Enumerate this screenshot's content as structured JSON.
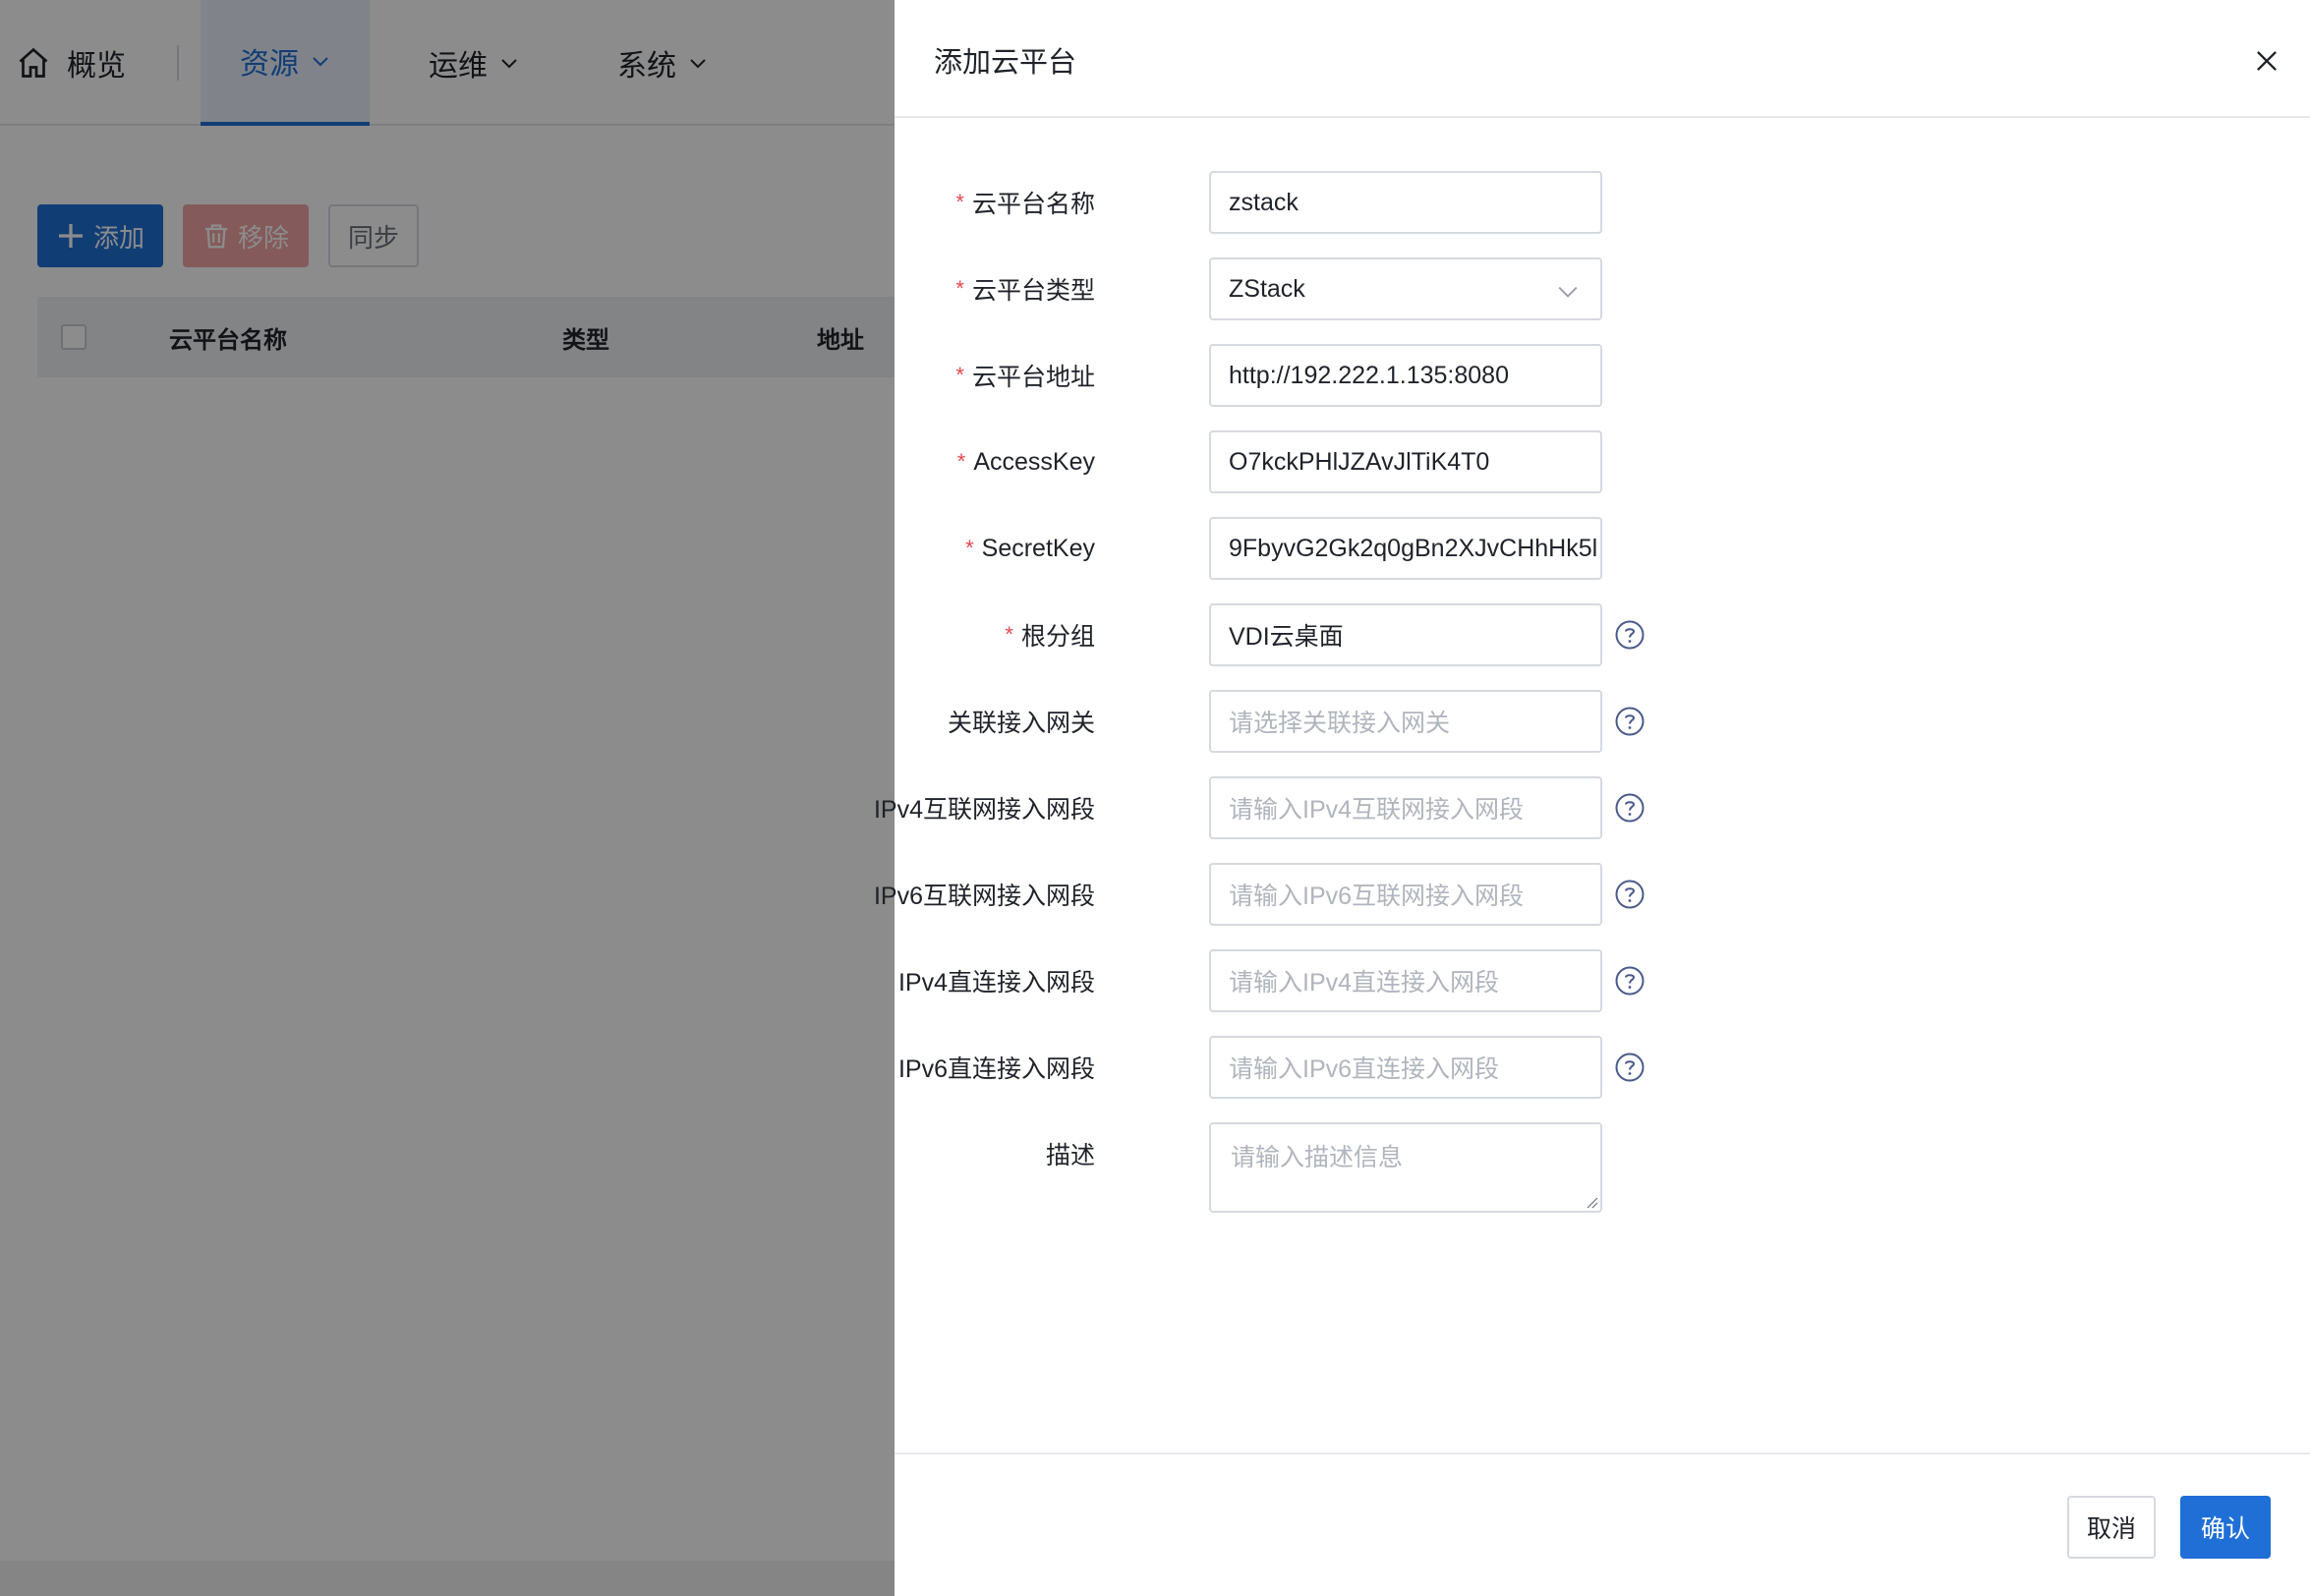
{
  "nav": {
    "overview": "概览",
    "resources": "资源",
    "operations": "运维",
    "system": "系统"
  },
  "toolbar": {
    "add_label": "添加",
    "remove_label": "移除",
    "sync_label": "同步"
  },
  "table": {
    "columns": [
      "云平台名称",
      "类型",
      "地址"
    ]
  },
  "drawer": {
    "title": "添加云平台",
    "fields": {
      "name": {
        "label": "云平台名称",
        "value": "zstack"
      },
      "type": {
        "label": "云平台类型",
        "value": "ZStack"
      },
      "address": {
        "label": "云平台地址",
        "value": "http://192.222.1.135:8080"
      },
      "access_key": {
        "label": "AccessKey",
        "value": "O7kckPHlJZAvJlTiK4T0"
      },
      "secret_key": {
        "label": "SecretKey",
        "value": "9FbyvG2Gk2q0gBn2XJvCHhHk5l"
      },
      "root_group": {
        "label": "根分组",
        "value": "VDI云桌面"
      },
      "gateway": {
        "label": "关联接入网关",
        "placeholder": "请选择关联接入网关"
      },
      "ipv4_internet": {
        "label": "IPv4互联网接入网段",
        "placeholder": "请输入IPv4互联网接入网段"
      },
      "ipv6_internet": {
        "label": "IPv6互联网接入网段",
        "placeholder": "请输入IPv6互联网接入网段"
      },
      "ipv4_direct": {
        "label": "IPv4直连接入网段",
        "placeholder": "请输入IPv4直连接入网段"
      },
      "ipv6_direct": {
        "label": "IPv6直连接入网段",
        "placeholder": "请输入IPv6直连接入网段"
      },
      "description": {
        "label": "描述",
        "placeholder": "请输入描述信息"
      }
    },
    "required_mark": "*",
    "cancel_label": "取消",
    "confirm_label": "确认"
  },
  "colors": {
    "primary": "#1f6fd6",
    "danger_disabled": "#f3a5a5",
    "required": "#e5484d"
  }
}
